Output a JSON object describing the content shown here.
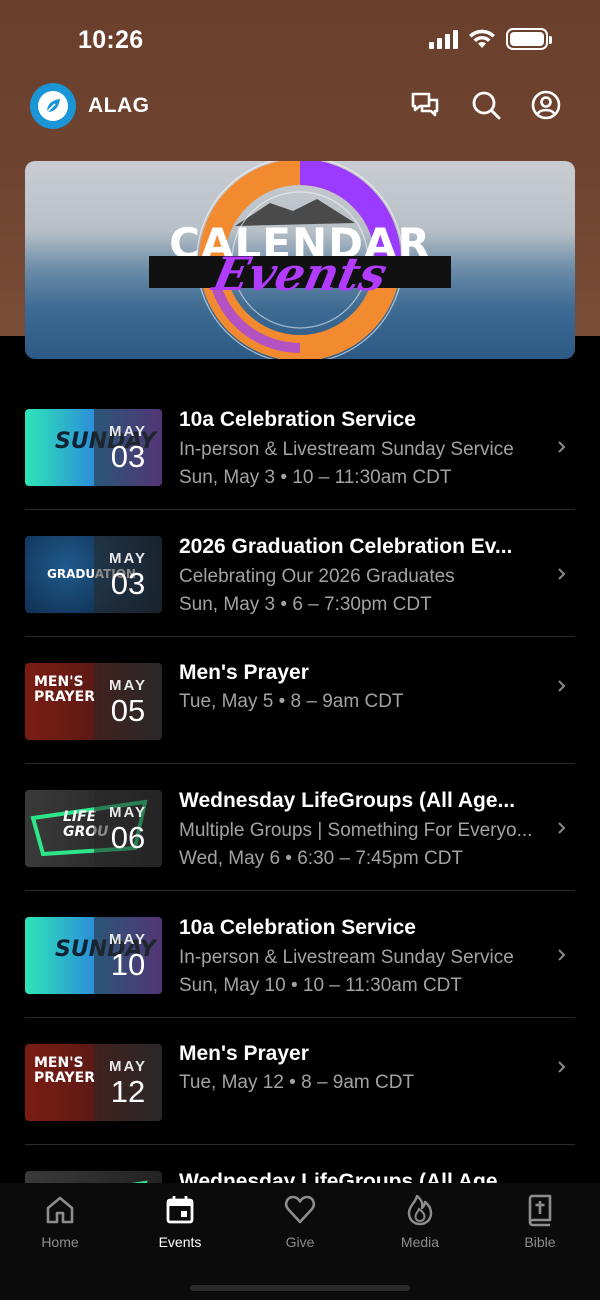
{
  "status_bar": {
    "time": "10:26"
  },
  "app": {
    "name": "ALAG"
  },
  "header_actions": [
    {
      "icon": "chat-icon"
    },
    {
      "icon": "search-icon"
    },
    {
      "icon": "profile-icon"
    }
  ],
  "hero": {
    "title": "CALENDAR",
    "script": "Events"
  },
  "events": [
    {
      "title": "10a Celebration Service",
      "description": "In-person & Livestream Sunday Service",
      "when": "Sun, May 3 • 10 – 11:30am CDT",
      "month": "MAY",
      "day": "03",
      "thumb": "sunday",
      "thumb_caption": "SUNDAY"
    },
    {
      "title": "2026 Graduation Celebration Ev...",
      "description": "Celebrating Our 2026 Graduates",
      "when": "Sun, May 3 • 6 – 7:30pm CDT",
      "month": "MAY",
      "day": "03",
      "thumb": "graduation",
      "thumb_caption": "GRADUATION"
    },
    {
      "title": "Men's Prayer",
      "description": "",
      "when": "Tue, May 5 • 8 – 9am CDT",
      "month": "MAY",
      "day": "05",
      "thumb": "mens",
      "thumb_caption": "MEN'S PRAYER"
    },
    {
      "title": "Wednesday LifeGroups (All Age...",
      "description": "Multiple Groups | Something For Everyo...",
      "when": "Wed, May 6 • 6:30 – 7:45pm CDT",
      "month": "MAY",
      "day": "06",
      "thumb": "lifegroups",
      "thumb_caption": "LIFE GROU"
    },
    {
      "title": "10a Celebration Service",
      "description": "In-person & Livestream Sunday Service",
      "when": "Sun, May 10 • 10 – 11:30am CDT",
      "month": "MAY",
      "day": "10",
      "thumb": "sunday",
      "thumb_caption": "SUNDAY"
    },
    {
      "title": "Men's Prayer",
      "description": "",
      "when": "Tue, May 12 • 8 – 9am CDT",
      "month": "MAY",
      "day": "12",
      "thumb": "mens",
      "thumb_caption": "MEN'S PRAYER"
    },
    {
      "title": "Wednesday LifeGroups (All Age...",
      "description": "",
      "when": "",
      "month": "",
      "day": "",
      "thumb": "lifegroups",
      "thumb_caption": ""
    }
  ],
  "tabs": [
    {
      "label": "Home",
      "icon": "home-icon",
      "active": false
    },
    {
      "label": "Events",
      "icon": "calendar-icon",
      "active": true
    },
    {
      "label": "Give",
      "icon": "heart-icon",
      "active": false
    },
    {
      "label": "Media",
      "icon": "flame-icon",
      "active": false
    },
    {
      "label": "Bible",
      "icon": "bible-icon",
      "active": false
    }
  ],
  "colors": {
    "header_brown": "#6f4531",
    "accent_blue": "#1a95d6",
    "subtext_gray": "#a2a2a2"
  }
}
